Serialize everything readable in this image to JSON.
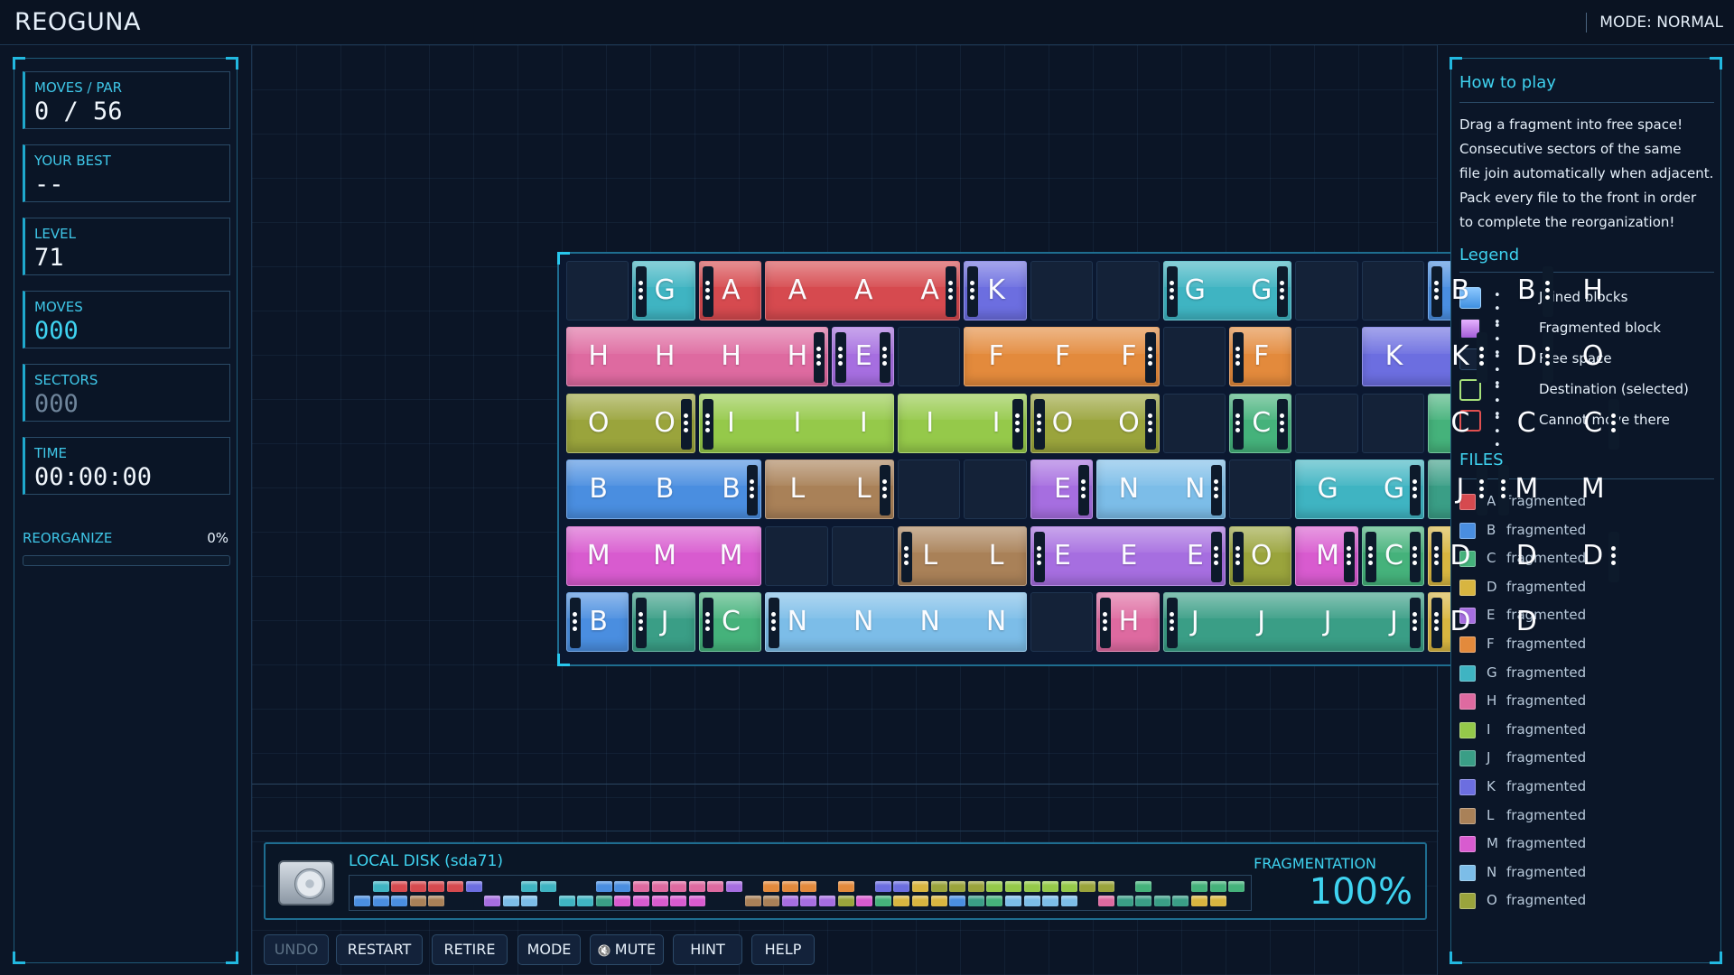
{
  "header": {
    "title": "REOGUNA",
    "mode": "MODE: NORMAL"
  },
  "stats": [
    {
      "label": "MOVES / PAR",
      "value": "0 / 56",
      "style": ""
    },
    {
      "label": "YOUR BEST",
      "value": "--",
      "style": ""
    },
    {
      "label": "LEVEL",
      "value": "71",
      "style": ""
    },
    {
      "label": "MOVES",
      "value": "000",
      "style": "cyan"
    },
    {
      "label": "SECTORS",
      "value": "000",
      "style": "dim"
    },
    {
      "label": "TIME",
      "value": "00:00:00",
      "style": ""
    }
  ],
  "reorganize": {
    "label": "REORGANIZE",
    "percent": "0%",
    "progress": 0
  },
  "colors": {
    "A": "#d64a4f",
    "B": "#4a8ee0",
    "C": "#45b27b",
    "D": "#d8b540",
    "E": "#a66ee0",
    "F": "#e38a3c",
    "G": "#3fb4c2",
    "H": "#de6aa0",
    "I": "#95c94a",
    "J": "#3a9e86",
    "K": "#6c6ee0",
    "L": "#a98158",
    "M": "#d85bcf",
    "N": "#7cbde8",
    "O": "#9aa43c"
  },
  "board": {
    "rows": [
      [
        {
          "t": "free",
          "span": 1
        },
        {
          "t": "blk",
          "span": 1,
          "letters": [
            "G"
          ],
          "l": 1,
          "r": 0
        },
        {
          "t": "blk",
          "span": 1,
          "letters": [
            "A"
          ],
          "l": 2,
          "r": 0
        },
        {
          "t": "blk",
          "span": 3,
          "letters": [
            "A",
            "A",
            "A"
          ],
          "l": 0,
          "r": 2
        },
        {
          "t": "blk",
          "span": 1,
          "letters": [
            "K"
          ],
          "l": 1,
          "r": 0
        },
        {
          "t": "free",
          "span": 1
        },
        {
          "t": "free",
          "span": 1
        },
        {
          "t": "blk",
          "span": 2,
          "letters": [
            "G",
            "G"
          ],
          "l": 1,
          "r": 1
        },
        {
          "t": "free",
          "span": 1
        },
        {
          "t": "free",
          "span": 1
        },
        {
          "t": "blk",
          "span": 2,
          "letters": [
            "B",
            "B"
          ],
          "l": 1,
          "r": 2
        },
        {
          "t": "blk",
          "span": 1,
          "letters": [
            "H"
          ],
          "l": 0,
          "r": 0
        }
      ],
      [
        {
          "t": "blk",
          "span": 4,
          "letters": [
            "H",
            "H",
            "H",
            "H"
          ],
          "l": 0,
          "r": 1
        },
        {
          "t": "blk",
          "span": 1,
          "letters": [
            "E"
          ],
          "l": 1,
          "r": 1
        },
        {
          "t": "free",
          "span": 1
        },
        {
          "t": "blk",
          "span": 3,
          "letters": [
            "F",
            "F",
            "F"
          ],
          "l": 0,
          "r": 1
        },
        {
          "t": "free",
          "span": 1
        },
        {
          "t": "blk",
          "span": 1,
          "letters": [
            "F"
          ],
          "l": 1,
          "r": 0
        },
        {
          "t": "free",
          "span": 1
        },
        {
          "t": "blk",
          "span": 2,
          "letters": [
            "K",
            "K"
          ],
          "l": 0,
          "r": 1
        },
        {
          "t": "blk",
          "span": 1,
          "letters": [
            "D"
          ],
          "l": 0,
          "r": 2
        },
        {
          "t": "blk",
          "span": 1,
          "letters": [
            "O"
          ],
          "l": 0,
          "r": 0
        }
      ],
      [
        {
          "t": "blk",
          "span": 2,
          "letters": [
            "O",
            "O"
          ],
          "l": 0,
          "r": 2
        },
        {
          "t": "blk",
          "span": 3,
          "letters": [
            "I",
            "I",
            "I"
          ],
          "l": 1,
          "r": 0
        },
        {
          "t": "blk",
          "span": 2,
          "letters": [
            "I",
            "I"
          ],
          "l": 0,
          "r": 1
        },
        {
          "t": "blk",
          "span": 2,
          "letters": [
            "O",
            "O"
          ],
          "l": 2,
          "r": 1
        },
        {
          "t": "free",
          "span": 1
        },
        {
          "t": "blk",
          "span": 1,
          "letters": [
            "C"
          ],
          "l": 2,
          "r": 1
        },
        {
          "t": "free",
          "span": 1
        },
        {
          "t": "free",
          "span": 1
        },
        {
          "t": "blk",
          "span": 3,
          "letters": [
            "C",
            "C",
            "C"
          ],
          "l": 0,
          "r": 1
        }
      ],
      [
        {
          "t": "blk",
          "span": 3,
          "letters": [
            "B",
            "B",
            "B"
          ],
          "l": 0,
          "r": 1
        },
        {
          "t": "blk",
          "span": 2,
          "letters": [
            "L",
            "L"
          ],
          "l": 0,
          "r": 1
        },
        {
          "t": "free",
          "span": 1
        },
        {
          "t": "free",
          "span": 1
        },
        {
          "t": "blk",
          "span": 1,
          "letters": [
            "E"
          ],
          "l": 0,
          "r": 1
        },
        {
          "t": "blk",
          "span": 2,
          "letters": [
            "N",
            "N"
          ],
          "l": 0,
          "r": 1
        },
        {
          "t": "free",
          "span": 1
        },
        {
          "t": "blk",
          "span": 2,
          "letters": [
            "G",
            "G"
          ],
          "l": 0,
          "r": 1
        },
        {
          "t": "blk",
          "span": 1,
          "letters": [
            "J"
          ],
          "l": 0,
          "r": 1
        },
        {
          "t": "blk",
          "span": 2,
          "letters": [
            "M",
            "M"
          ],
          "l": 1,
          "r": 0
        }
      ],
      [
        {
          "t": "blk",
          "span": 3,
          "letters": [
            "M",
            "M",
            "M"
          ],
          "l": 0,
          "r": 0
        },
        {
          "t": "free",
          "span": 1
        },
        {
          "t": "free",
          "span": 1
        },
        {
          "t": "blk",
          "span": 2,
          "letters": [
            "L",
            "L"
          ],
          "l": 1,
          "r": 0
        },
        {
          "t": "blk",
          "span": 3,
          "letters": [
            "E",
            "E",
            "E"
          ],
          "l": 1,
          "r": 1
        },
        {
          "t": "blk",
          "span": 1,
          "letters": [
            "O"
          ],
          "l": 1,
          "r": 0
        },
        {
          "t": "blk",
          "span": 1,
          "letters": [
            "M"
          ],
          "l": 0,
          "r": 1
        },
        {
          "t": "blk",
          "span": 1,
          "letters": [
            "C"
          ],
          "l": 1,
          "r": 1
        },
        {
          "t": "blk",
          "span": 3,
          "letters": [
            "D",
            "D",
            "D"
          ],
          "l": 2,
          "r": 2
        }
      ],
      [
        {
          "t": "blk",
          "span": 1,
          "letters": [
            "B"
          ],
          "l": 2,
          "r": 0
        },
        {
          "t": "blk",
          "span": 1,
          "letters": [
            "J"
          ],
          "l": 2,
          "r": 0
        },
        {
          "t": "blk",
          "span": 1,
          "letters": [
            "C"
          ],
          "l": 1,
          "r": 0
        },
        {
          "t": "blk",
          "span": 4,
          "letters": [
            "N",
            "N",
            "N",
            "N"
          ],
          "l": 1,
          "r": 0
        },
        {
          "t": "free",
          "span": 1
        },
        {
          "t": "blk",
          "span": 1,
          "letters": [
            "H"
          ],
          "l": 1,
          "r": 0
        },
        {
          "t": "blk",
          "span": 4,
          "letters": [
            "J",
            "J",
            "J",
            "J"
          ],
          "l": 1,
          "r": 2
        },
        {
          "t": "blk",
          "span": 2,
          "letters": [
            "D",
            "D"
          ],
          "l": 2,
          "r": 0
        },
        {
          "t": "free",
          "span": 1
        }
      ]
    ]
  },
  "disk": {
    "title": "LOCAL DISK (sda71)",
    "fragmentation_label": "FRAGMENTATION",
    "fragmentation_value": "100%",
    "row1": [
      "",
      "G",
      "A",
      "A",
      "A",
      "A",
      "K",
      "",
      "",
      "G",
      "G",
      "",
      "",
      "B",
      "B",
      "H",
      "H",
      "H",
      "H",
      "H",
      "E",
      "",
      "F",
      "F",
      "F",
      "",
      "F",
      "",
      "K",
      "K",
      "D",
      "O",
      "O",
      "O",
      "I",
      "I",
      "I",
      "I",
      "I",
      "O",
      "O",
      "",
      "C",
      "",
      "",
      "C",
      "C",
      "C"
    ],
    "row2": [
      "B",
      "B",
      "B",
      "L",
      "L",
      "",
      "",
      "E",
      "N",
      "N",
      "",
      "G",
      "G",
      "J",
      "M",
      "M",
      "M",
      "M",
      "M",
      "",
      "",
      "L",
      "L",
      "E",
      "E",
      "E",
      "O",
      "M",
      "C",
      "D",
      "D",
      "D",
      "B",
      "J",
      "C",
      "N",
      "N",
      "N",
      "N",
      "",
      "H",
      "J",
      "J",
      "J",
      "J",
      "D",
      "D",
      ""
    ]
  },
  "buttons": [
    {
      "label": "UNDO",
      "disabled": true
    },
    {
      "label": "RESTART",
      "disabled": false
    },
    {
      "label": "RETIRE",
      "disabled": false
    },
    {
      "label": "MODE",
      "disabled": false
    },
    {
      "label": "MUTE",
      "disabled": false,
      "icon": "mute-icon"
    },
    {
      "label": "HINT",
      "disabled": false
    },
    {
      "label": "HELP",
      "disabled": false
    }
  ],
  "howto": {
    "title": "How to play",
    "lines": [
      "Drag a fragment into free space!",
      "Consecutive sectors of the same",
      "file join automatically when adjacent.",
      "Pack every file to the front in order",
      "to complete the reorganization!"
    ]
  },
  "legend": {
    "title": "Legend",
    "items": [
      {
        "text": "Joined blocks",
        "kind": "joined"
      },
      {
        "text": "Fragmented block",
        "kind": "fragmented"
      },
      {
        "text": "Free space",
        "kind": "free"
      },
      {
        "text": "Destination (selected)",
        "kind": "destination"
      },
      {
        "text": "Cannot move there",
        "kind": "blocked"
      }
    ]
  },
  "files": {
    "title": "FILES",
    "items": [
      {
        "letter": "A",
        "status": "fragmented"
      },
      {
        "letter": "B",
        "status": "fragmented"
      },
      {
        "letter": "C",
        "status": "fragmented"
      },
      {
        "letter": "D",
        "status": "fragmented"
      },
      {
        "letter": "E",
        "status": "fragmented"
      },
      {
        "letter": "F",
        "status": "fragmented"
      },
      {
        "letter": "G",
        "status": "fragmented"
      },
      {
        "letter": "H",
        "status": "fragmented"
      },
      {
        "letter": "I",
        "status": "fragmented"
      },
      {
        "letter": "J",
        "status": "fragmented"
      },
      {
        "letter": "K",
        "status": "fragmented"
      },
      {
        "letter": "L",
        "status": "fragmented"
      },
      {
        "letter": "M",
        "status": "fragmented"
      },
      {
        "letter": "N",
        "status": "fragmented"
      },
      {
        "letter": "O",
        "status": "fragmented"
      }
    ]
  }
}
